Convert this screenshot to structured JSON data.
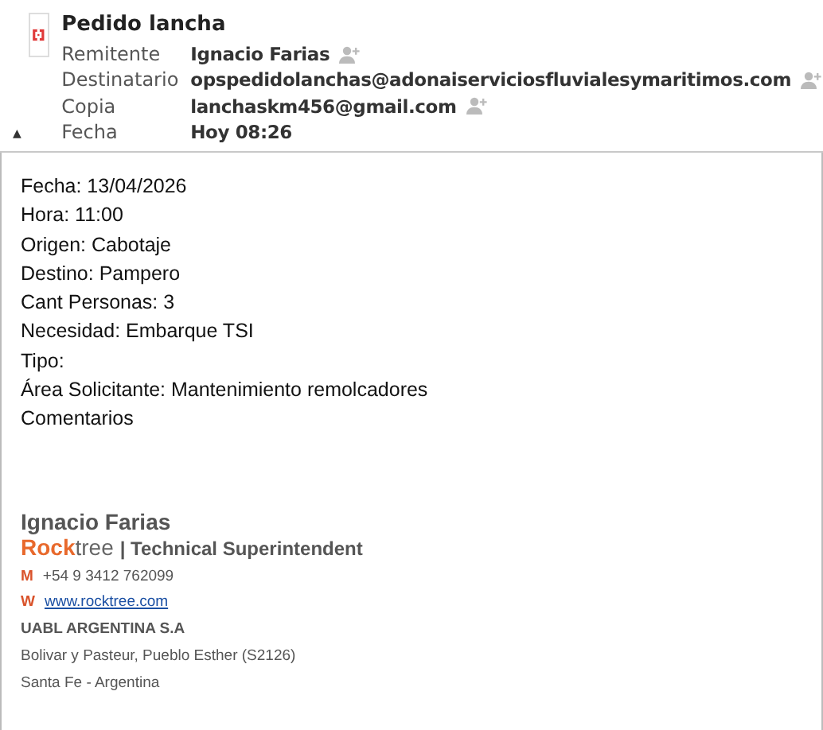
{
  "header": {
    "subject": "Pedido lancha",
    "collapsed_toggle": "▲",
    "fields": [
      {
        "label": "Remitente",
        "value": "Ignacio Farias",
        "add_contact": true
      },
      {
        "label": "Destinatario",
        "value": "opspedidolanchas@adonaiserviciosfluvialesymaritimos.com",
        "add_contact": true
      },
      {
        "label": "Copia",
        "value": "lanchaskm456@gmail.com",
        "add_contact": true
      },
      {
        "label": "Fecha",
        "value": "Hoy 08:26",
        "add_contact": false
      }
    ]
  },
  "body": {
    "lines": [
      "Fecha: 13/04/2026",
      "Hora: 11:00",
      "Origen: Cabotaje",
      "Destino: Pampero",
      "Cant Personas: 3",
      "Necesidad: Embarque TSI",
      "Tipo:",
      "Área Solicitante: Mantenimiento remolcadores",
      "Comentarios"
    ]
  },
  "signature": {
    "name": "Ignacio Farias",
    "brand_bold": "Rock",
    "brand_rest": "tree",
    "role": "| Technical Superintendent",
    "contacts": [
      {
        "key": "M",
        "value": "+54 9 3412 762099",
        "kind": "text"
      },
      {
        "key": "W",
        "value": "www.rocktree.com",
        "kind": "link"
      }
    ],
    "company": "UABL ARGENTINA S.A",
    "address_lines": [
      "Bolivar y Pasteur, Pueblo Esther (S2126)",
      "Santa Fe - Argentina"
    ]
  }
}
